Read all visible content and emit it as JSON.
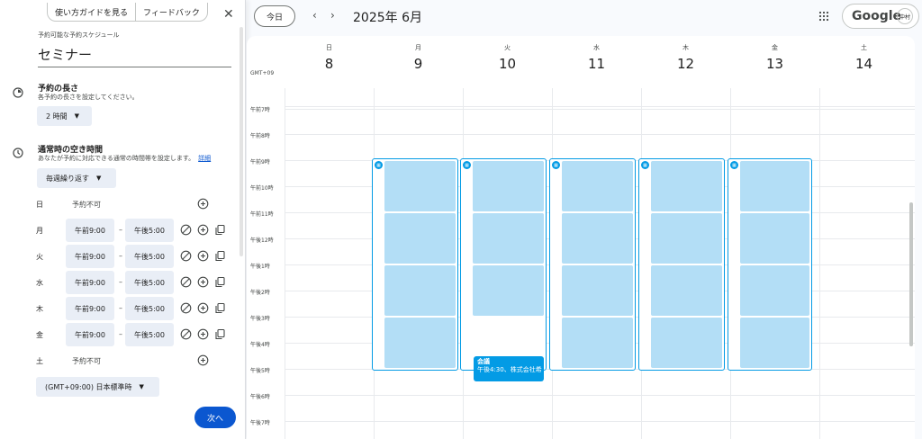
{
  "panel": {
    "help_button": "使い方ガイドを見る",
    "feedback_button": "フィードバック",
    "schedule_label": "予約可能な予約スケジュール",
    "schedule_title": "セミナー",
    "duration": {
      "title": "予約の長さ",
      "subtitle": "各予約の長さを設定してください。",
      "value": "2 時間"
    },
    "availability": {
      "title": "通常時の空き時間",
      "subtitle": "あなたが予約に対応できる通常の時間帯を設定します。",
      "details_link": "詳細",
      "repeat": "毎週繰り返す"
    },
    "days": [
      {
        "day": "日",
        "available": false,
        "status": "予約不可"
      },
      {
        "day": "月",
        "available": true,
        "start": "午前9:00",
        "end": "午後5:00"
      },
      {
        "day": "火",
        "available": true,
        "start": "午前9:00",
        "end": "午後5:00"
      },
      {
        "day": "水",
        "available": true,
        "start": "午前9:00",
        "end": "午後5:00"
      },
      {
        "day": "木",
        "available": true,
        "start": "午前9:00",
        "end": "午後5:00"
      },
      {
        "day": "金",
        "available": true,
        "start": "午前9:00",
        "end": "午後5:00"
      },
      {
        "day": "土",
        "available": false,
        "status": "予約不可"
      }
    ],
    "range_separator": "–",
    "timezone": "(GMT+09:00) 日本標準時",
    "next_button": "次へ"
  },
  "header": {
    "today": "今日",
    "month": "2025年 6月",
    "google": "Google",
    "avatar": "中村"
  },
  "calendar": {
    "tz_label": "GMT+09",
    "days": [
      {
        "weekday": "日",
        "date": "8"
      },
      {
        "weekday": "月",
        "date": "9"
      },
      {
        "weekday": "火",
        "date": "10"
      },
      {
        "weekday": "水",
        "date": "11"
      },
      {
        "weekday": "木",
        "date": "12"
      },
      {
        "weekday": "金",
        "date": "13"
      },
      {
        "weekday": "土",
        "date": "14"
      }
    ],
    "hours": [
      "午前7時",
      "午前8時",
      "午前9時",
      "午前10時",
      "午前11時",
      "午後12時",
      "午後1時",
      "午後2時",
      "午後3時",
      "午後4時",
      "午後5時",
      "午後6時",
      "午後7時"
    ],
    "event": {
      "title": "会議",
      "subtitle": "午後4:30、株式会社希"
    },
    "accent": "#039be5",
    "slot_color": "#b3def6"
  }
}
